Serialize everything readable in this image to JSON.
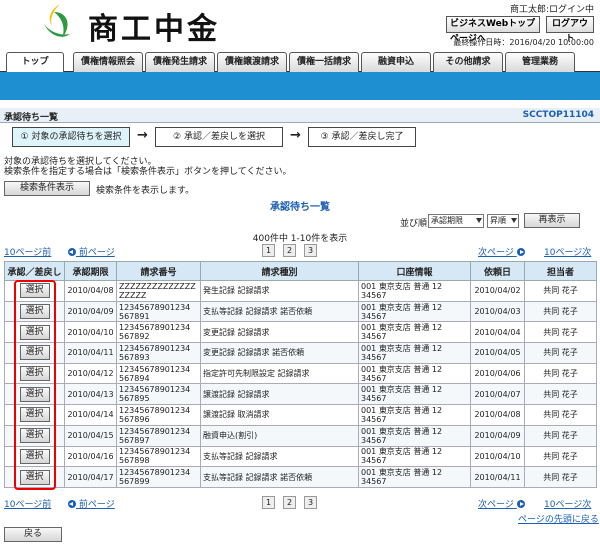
{
  "header": {
    "logo_text": "商工中金",
    "user_name": "商工太郎:ログイン中",
    "top_page_button": "ビジネスWebトップページへ",
    "logout_button": "ログアウト",
    "last_operation": "最終操作日時：2016/04/20 10:00:00"
  },
  "tabs": [
    "トップ",
    "債権情報照会",
    "債権発生請求",
    "債権譲渡請求",
    "債権一括請求",
    "融資申込",
    "その他請求",
    "管理業務"
  ],
  "page": {
    "title": "承認待ち一覧",
    "screen_id": "SCCTOP11104"
  },
  "steps": [
    "① 対象の承認待ちを選択",
    "② 承認／差戻しを選択",
    "③ 承認／差戻し完了"
  ],
  "arrow": "→",
  "instructions": [
    "対象の承認待ちを選択してください。",
    "検索条件を指定する場合は「検索条件表示」ボタンを押してください。"
  ],
  "search": {
    "button": "検索条件表示",
    "hint": "検索条件を表示します。"
  },
  "list_title": "承認待ち一覧",
  "sort": {
    "label": "並び順:",
    "field": "承認期限",
    "order": "昇順",
    "button": "再表示"
  },
  "pagination": {
    "count_text": "400件中 1-10件を表示",
    "prev10": "10ページ前",
    "prev": "前ページ",
    "next": "次ページ",
    "next10": "10ページ次",
    "pages": [
      "1",
      "2",
      "3"
    ],
    "to_top": "ページの先頭に戻る"
  },
  "table": {
    "headers": [
      "承認／差戻し",
      "承認期限",
      "請求番号",
      "請求種別",
      "口座情報",
      "依頼日",
      "担当者"
    ],
    "select_label": "選択",
    "rows": [
      {
        "deadline": "2010/04/08",
        "number": "ZZZZZZZZZZZZZZ\nZZZZZ",
        "type": "発生記録 記録請求",
        "account": "001 東京支店 普通 12\n34567",
        "date": "2010/04/02",
        "person": "共同 花子"
      },
      {
        "deadline": "2010/04/09",
        "number": "12345678901234\n567891",
        "type": "支払等記録 記録請求 諾否依頼",
        "account": "001 東京支店 普通 12\n34567",
        "date": "2010/04/03",
        "person": "共同 花子"
      },
      {
        "deadline": "2010/04/10",
        "number": "12345678901234\n567892",
        "type": "変更記録 記録請求",
        "account": "001 東京支店 普通 12\n34567",
        "date": "2010/04/04",
        "person": "共同 花子"
      },
      {
        "deadline": "2010/04/11",
        "number": "12345678901234\n567893",
        "type": "変更記録 記録請求 諾否依頼",
        "account": "001 東京支店 普通 12\n34567",
        "date": "2010/04/05",
        "person": "共同 花子"
      },
      {
        "deadline": "2010/04/12",
        "number": "12345678901234\n567894",
        "type": "指定許可先制限設定 記録請求",
        "account": "001 東京支店 普通 12\n34567",
        "date": "2010/04/06",
        "person": "共同 花子"
      },
      {
        "deadline": "2010/04/13",
        "number": "12345678901234\n567895",
        "type": "譲渡記録 記録請求",
        "account": "001 東京支店 普通 12\n34567",
        "date": "2010/04/07",
        "person": "共同 花子"
      },
      {
        "deadline": "2010/04/14",
        "number": "12345678901234\n567896",
        "type": "譲渡記録 取消請求",
        "account": "001 東京支店 普通 12\n34567",
        "date": "2010/04/08",
        "person": "共同 花子"
      },
      {
        "deadline": "2010/04/15",
        "number": "12345678901234\n567897",
        "type": "融資申込(割引)",
        "account": "001 東京支店 普通 12\n34567",
        "date": "2010/04/09",
        "person": "共同 花子"
      },
      {
        "deadline": "2010/04/16",
        "number": "12345678901234\n567898",
        "type": "支払等記録 記録請求",
        "account": "001 東京支店 普通 12\n34567",
        "date": "2010/04/10",
        "person": "共同 花子"
      },
      {
        "deadline": "2010/04/17",
        "number": "12345678901234\n567899",
        "type": "支払等記録 記録請求 諾否依頼",
        "account": "001 東京支店 普通 12\n34567",
        "date": "2010/04/11",
        "person": "共同 花子"
      }
    ]
  },
  "back_button": "戻る",
  "colors": {
    "brand_blue": "#1e8fd0",
    "link": "#1b5fb3",
    "highlight": "#e00000",
    "logo_green": "#2e9a3e",
    "logo_yellow": "#f2c200"
  }
}
